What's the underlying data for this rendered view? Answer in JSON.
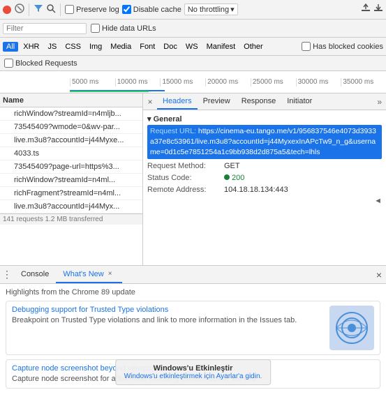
{
  "toolbar": {
    "preserve_log": "Preserve log",
    "disable_cache": "Disable cache",
    "throttle": "No throttling",
    "icons": {
      "record": "●",
      "clear": "🚫",
      "filter": "⚗",
      "search": "🔍",
      "export": "⬆",
      "import": "⬇"
    }
  },
  "filter_bar": {
    "placeholder": "Filter",
    "hide_data_urls": "Hide data URLs"
  },
  "type_bar": {
    "types": [
      "All",
      "XHR",
      "JS",
      "CSS",
      "Img",
      "Media",
      "Font",
      "Doc",
      "WS",
      "Manifest",
      "Other"
    ],
    "has_blocked_cookies": "Has blocked cookies",
    "blocked_requests": "Blocked Requests"
  },
  "timeline": {
    "marks": [
      "5000 ms",
      "10000 ms",
      "15000 ms",
      "20000 ms",
      "25000 ms",
      "30000 ms",
      "35000 ms"
    ]
  },
  "request_list": {
    "header": "Name",
    "items": [
      "richWindow?streamId=n4mljb...",
      "73545409?wmode=0&wv-par...",
      "live.m3u8?accountId=j44Myxe...",
      "4033.ts",
      "73545409?page-url=https%3...",
      "richWindow?streamId=n4ml...",
      "richFragment?streamId=n4ml...",
      "live.m3u8?accountId=j44Myx..."
    ],
    "footer": "141 requests    1.2 MB transferred"
  },
  "detail_panel": {
    "close_icon": "×",
    "tabs": [
      "Headers",
      "Preview",
      "Response",
      "Initiator"
    ],
    "more_icon": "»",
    "section_title": "eral",
    "request_url_label": "quest URL:",
    "request_url_value": "https://cinema-eu.tango.me/v1/956837546e4073d3933a37e8c53961/live.m3u8?accountId=j44MyxexInAPcTw9_n_g&username=0d1c5e7851254a1c9bb938d2d875a5&tech=lhls",
    "request_method_label": "quest Method:",
    "request_method_value": "GET",
    "status_code_label": "atus Code:",
    "status_code_value": "200",
    "remote_address_label": "mote Address:",
    "remote_address_value": "104.18.18.134:443",
    "scroll_indicator": "◄"
  },
  "bottom_panel": {
    "tabs": [
      "Console",
      "What's New"
    ],
    "close_icon": "×",
    "menu_icon": "⋮",
    "highlight_text": "Highlights from the Chrome 89 update",
    "updates": [
      {
        "title": "Debugging support for Trusted Type violations",
        "desc": "Breakpoint on Trusted Type violations and link to more information in the Issues tab.",
        "has_image": true
      },
      {
        "title": "Capture node screenshot beyond viewport",
        "desc": "Capture node screenshot for a full node including content below the fold.",
        "has_image": false
      }
    ]
  },
  "windows_overlay": {
    "title": "Windows'u Etkinleştir",
    "subtitle": "Windows'u etkinleştirmek için Ayarlar'a gidin."
  }
}
